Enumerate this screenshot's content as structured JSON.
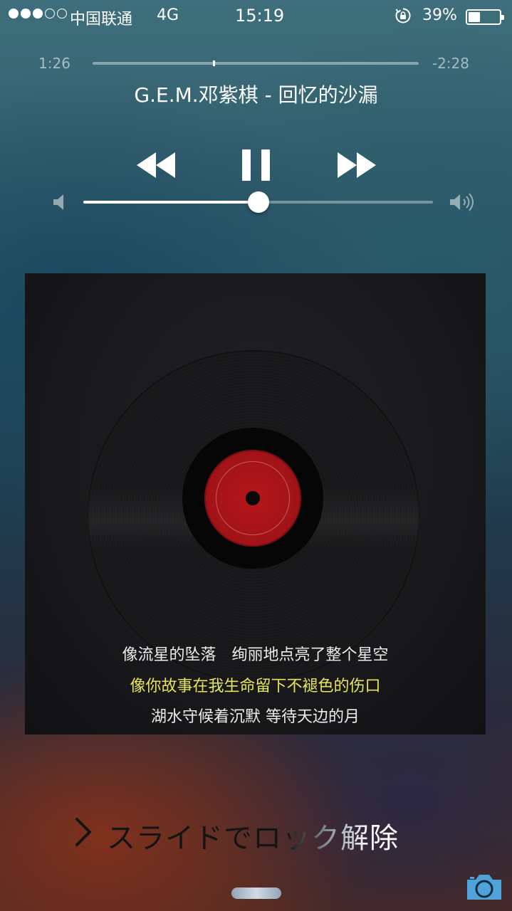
{
  "status_bar": {
    "signal_strength": 3,
    "signal_total": 5,
    "carrier": "中国联通",
    "network": "4G",
    "time": "15:19",
    "battery_percent": "39%",
    "battery_level": 0.39,
    "icons": [
      "rotation-lock-icon",
      "battery-icon"
    ]
  },
  "now_playing": {
    "elapsed": "1:26",
    "remaining": "-2:28",
    "progress": 0.37,
    "title": "G.E.M.邓紫棋 - 回忆的沙漏",
    "controls": {
      "previous": "rewind-icon",
      "play_pause": "pause-icon",
      "next": "fast-forward-icon"
    },
    "volume": 0.5
  },
  "album_art": {
    "lyrics": [
      "像流星的坠落　绚丽地点亮了整个星空",
      "像你故事在我生命留下不褪色的伤口",
      "湖水守候着沉默 等待天边的月"
    ],
    "highlight_color": "#e6e65a"
  },
  "lock_screen": {
    "unlock_text": "スライドでロック解除",
    "icons": [
      "chevron-right-icon",
      "camera-icon"
    ]
  },
  "colors": {
    "label_red": "#b5161b",
    "text": "#ffffff"
  }
}
